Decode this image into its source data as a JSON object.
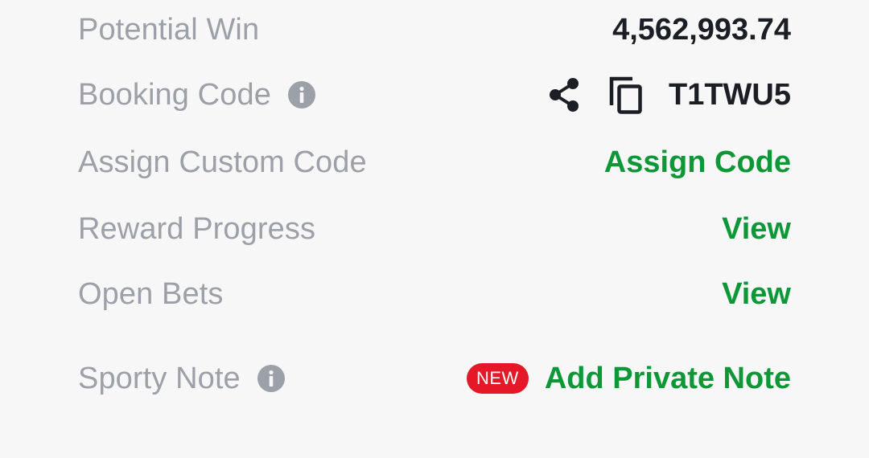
{
  "rows": {
    "potential_win": {
      "label": "Potential Win",
      "value": "4,562,993.74"
    },
    "booking_code": {
      "label": "Booking Code",
      "info_icon": "info-icon",
      "share_icon": "share-icon",
      "copy_icon": "copy-icon",
      "value": "T1TWU5"
    },
    "custom_code": {
      "label": "Assign Custom Code",
      "action": "Assign Code"
    },
    "reward_progress": {
      "label": "Reward Progress",
      "action": "View"
    },
    "open_bets": {
      "label": "Open Bets",
      "action": "View"
    },
    "sporty_note": {
      "label": "Sporty Note",
      "info_icon": "info-icon",
      "badge": "NEW",
      "action": "Add Private Note"
    }
  },
  "colors": {
    "background": "#f7f7f8",
    "label": "#9ca0a8",
    "value": "#1b1e24",
    "action_green": "#0d9737",
    "badge_red": "#e41827"
  }
}
